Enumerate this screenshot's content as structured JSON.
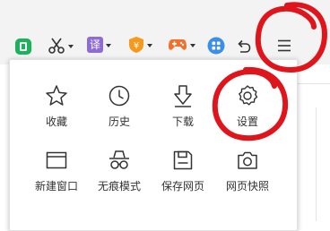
{
  "menu": {
    "row1": [
      {
        "label": "收藏",
        "icon": "star-icon"
      },
      {
        "label": "历史",
        "icon": "clock-icon"
      },
      {
        "label": "下载",
        "icon": "download-icon"
      },
      {
        "label": "设置",
        "icon": "gear-icon"
      }
    ],
    "row2": [
      {
        "label": "新建窗口",
        "icon": "new-window-icon"
      },
      {
        "label": "无痕模式",
        "icon": "incognito-icon"
      },
      {
        "label": "保存网页",
        "icon": "save-icon"
      },
      {
        "label": "网页快照",
        "icon": "camera-icon"
      }
    ]
  },
  "toolbar": {
    "translate_glyph": "译",
    "coupon_glyph": "¥"
  },
  "colors": {
    "annotation_red": "#e0141b",
    "translate_purple": "#8f6bd8",
    "coupon_orange": "#f39a1e",
    "game_orange": "#f36f2a",
    "app_blue": "#3d8fe6",
    "green_icon": "#19b35b"
  }
}
